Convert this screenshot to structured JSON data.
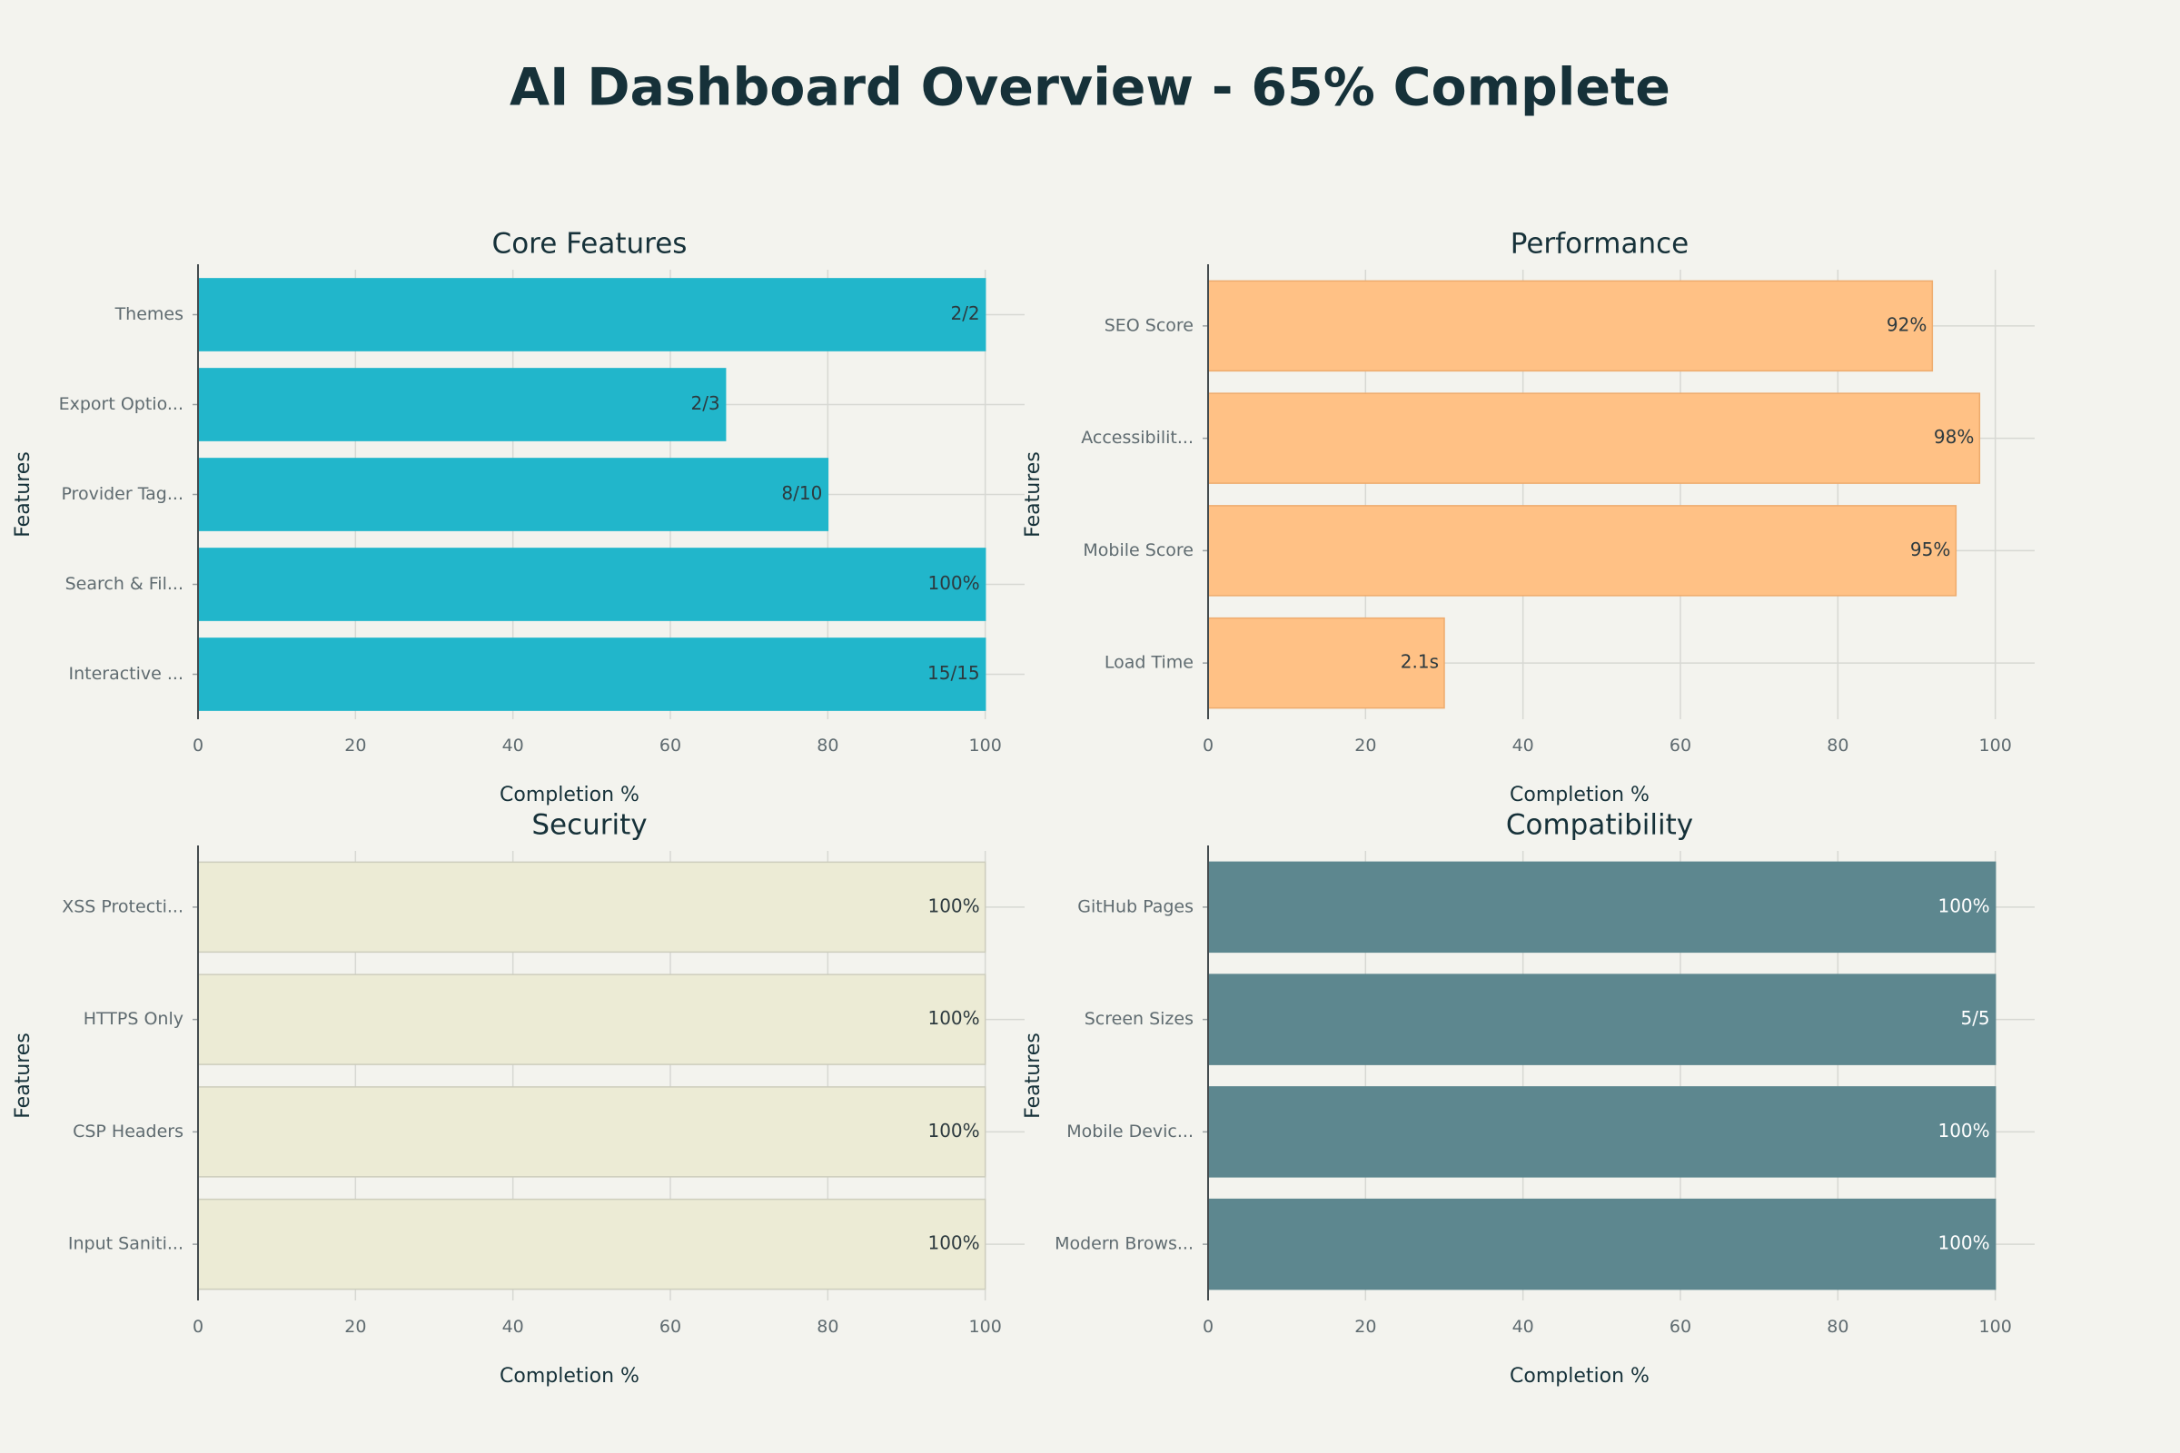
{
  "title": "AI Dashboard Overview - 65% Complete",
  "chart_data": [
    {
      "type": "bar",
      "orientation": "horizontal",
      "title": "Core Features",
      "xlabel": "Completion %",
      "ylabel": "Features",
      "xlim": [
        0,
        105
      ],
      "xticks": [
        0,
        20,
        40,
        60,
        80,
        100
      ],
      "categories": [
        "Themes",
        "Export Optio...",
        "Provider Tag...",
        "Search & Fil...",
        "Interactive ..."
      ],
      "values": [
        100,
        67,
        80,
        100,
        100
      ],
      "labels": [
        "2/2",
        "2/3",
        "8/10",
        "100%",
        "15/15"
      ],
      "bar_color": "#21b6cb",
      "bar_border": "#21b6cb",
      "label_color": "#2d3a3f",
      "grid": true
    },
    {
      "type": "bar",
      "orientation": "horizontal",
      "title": "Performance",
      "xlabel": "Completion %",
      "ylabel": "Features",
      "xlim": [
        0,
        105
      ],
      "xticks": [
        0,
        20,
        40,
        60,
        80,
        100
      ],
      "categories": [
        "SEO Score",
        "Accessibilit...",
        "Mobile Score",
        "Load Time"
      ],
      "values": [
        92,
        98,
        95,
        30
      ],
      "labels": [
        "92%",
        "98%",
        "95%",
        "2.1s"
      ],
      "bar_color": "#ffc185",
      "bar_border": "#eeab6d",
      "label_color": "#2d3a3f",
      "grid": true
    },
    {
      "type": "bar",
      "orientation": "horizontal",
      "title": "Security",
      "xlabel": "Completion %",
      "ylabel": "Features",
      "xlim": [
        0,
        105
      ],
      "xticks": [
        0,
        20,
        40,
        60,
        80,
        100
      ],
      "categories": [
        "XSS Protecti...",
        "HTTPS Only",
        "CSP Headers",
        "Input Saniti..."
      ],
      "values": [
        100,
        100,
        100,
        100
      ],
      "labels": [
        "100%",
        "100%",
        "100%",
        "100%"
      ],
      "bar_color": "#ecebd5",
      "bar_border": "#cdcdbd",
      "label_color": "#2d3a3f",
      "grid": true
    },
    {
      "type": "bar",
      "orientation": "horizontal",
      "title": "Compatibility",
      "xlabel": "Completion %",
      "ylabel": "Features",
      "xlim": [
        0,
        105
      ],
      "xticks": [
        0,
        20,
        40,
        60,
        80,
        100
      ],
      "categories": [
        "GitHub Pages",
        "Screen Sizes",
        "Mobile Devic...",
        "Modern Brows..."
      ],
      "values": [
        100,
        100,
        100,
        100
      ],
      "labels": [
        "100%",
        "5/5",
        "100%",
        "100%"
      ],
      "bar_color": "#5d878f",
      "bar_border": "#5d878f",
      "label_color": "#ffffff",
      "grid": true
    }
  ]
}
